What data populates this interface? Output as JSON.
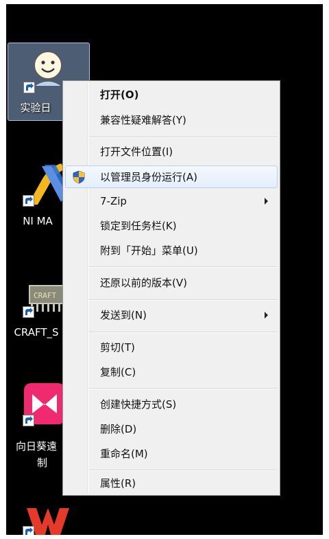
{
  "desktop": {
    "icons": [
      {
        "label": "实验日"
      },
      {
        "label": "NI MA"
      },
      {
        "label": "CRAFT_S"
      },
      {
        "label_line1": "向日葵遠",
        "label_line2": "制"
      },
      {
        "label": ""
      }
    ]
  },
  "context_menu": {
    "open": "打开(O)",
    "compat_troubleshoot": "兼容性疑难解答(Y)",
    "open_file_location": "打开文件位置(I)",
    "run_as_admin": "以管理员身份运行(A)",
    "seven_zip": "7-Zip",
    "pin_taskbar": "锁定到任务栏(K)",
    "pin_start": "附到「开始」菜单(U)",
    "restore_previous": "还原以前的版本(V)",
    "send_to": "发送到(N)",
    "cut": "剪切(T)",
    "copy": "复制(C)",
    "create_shortcut": "创建快捷方式(S)",
    "delete": "删除(D)",
    "rename": "重命名(M)",
    "properties": "属性(R)"
  },
  "colors": {
    "desktop_bg": "#000000",
    "menu_bg": "#f0f0f0",
    "hover_border": "#b9d1ef",
    "selection_bg": "#8caad2"
  },
  "icons": {
    "uac": "uac-shield-icon",
    "submenu": "submenu-arrow-icon",
    "shortcut": "shortcut-arrow-icon"
  }
}
